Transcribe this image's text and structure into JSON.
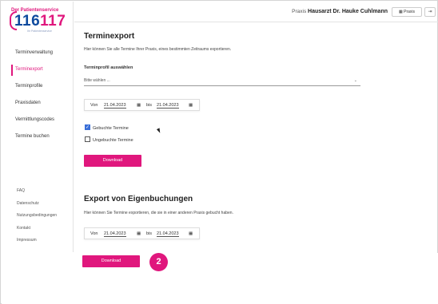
{
  "logo": {
    "top": "Der Patientenservice",
    "number_a": "116",
    "number_b": "117",
    "sub": "Ihr Patientenservice"
  },
  "sidebar": {
    "items": [
      {
        "label": "Terminverwaltung"
      },
      {
        "label": "Terminexport",
        "active": true
      },
      {
        "label": "Terminprofile"
      },
      {
        "label": "Praxisdaten"
      },
      {
        "label": "Vermittlungscodes"
      },
      {
        "label": "Termine buchen"
      }
    ],
    "footer": [
      {
        "label": "FAQ"
      },
      {
        "label": "Datenschutz"
      },
      {
        "label": "Nutzungsbedingungen"
      },
      {
        "label": "Kontakt"
      },
      {
        "label": "Impressum"
      }
    ]
  },
  "header": {
    "practice_prefix": "Praxis",
    "practice_name": "Hausarzt Dr. Hauke Cuhlmann",
    "praxis_button": "Praxis",
    "logout_icon": "logout-icon"
  },
  "export": {
    "title": "Terminexport",
    "description": "Hier können Sie alle Termine Ihrer Praxis, eines bestimmten Zeitraums exportieren.",
    "profile_label": "Terminprofil auswählen",
    "select_value": "Bitte wählen ...",
    "from_label": "Von",
    "from_date": "21.04.2023",
    "to_label": "bis",
    "to_date": "21.04.2023",
    "check_booked": "Gebuchte Termine",
    "check_unbooked": "Ungebuchte Termine",
    "download": "Download"
  },
  "own": {
    "title": "Export von Eigenbuchungen",
    "description": "Hier können Sie Termine exportieren, die sie in einer anderen Praxis gebucht haben.",
    "from_label": "Von",
    "from_date": "21.04.2023",
    "to_label": "bis",
    "to_date": "21.04.2023",
    "download": "Download"
  },
  "step_badge": "2",
  "colors": {
    "accent": "#e0177d",
    "brand_blue": "#0e4a9e",
    "checkbox": "#3a6fd8"
  }
}
